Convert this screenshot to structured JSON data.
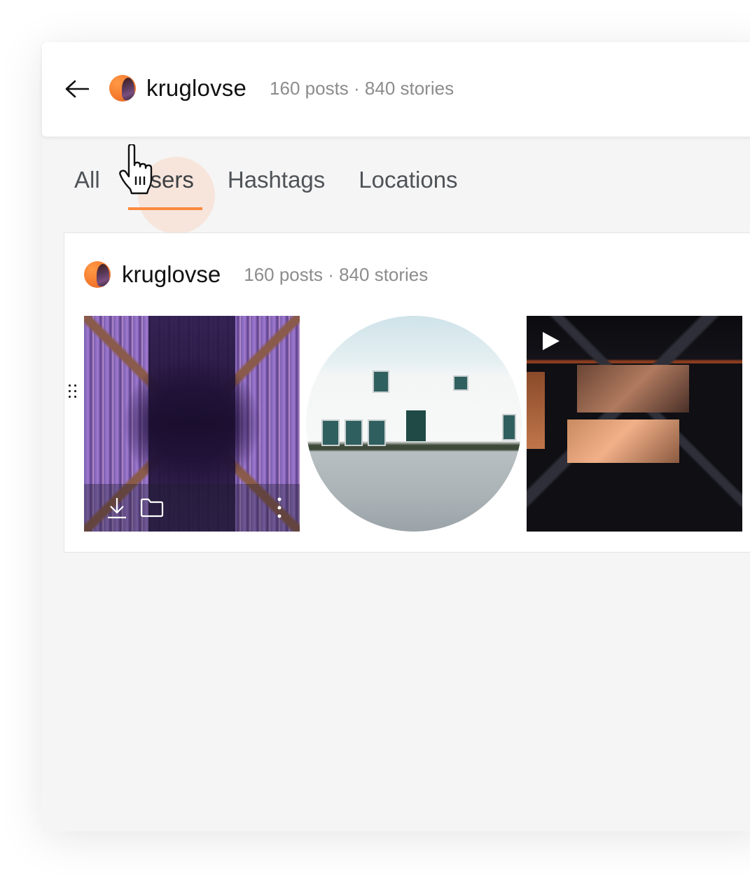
{
  "header": {
    "back_label": "Back",
    "username": "kruglovse",
    "stats": "160 posts · 840 stories"
  },
  "tabs": [
    {
      "label": "All",
      "active": false
    },
    {
      "label": "Users",
      "active": true
    },
    {
      "label": "Hashtags",
      "active": false
    },
    {
      "label": "Locations",
      "active": false
    }
  ],
  "result_card": {
    "username": "kruglovse",
    "stats": "160 posts · 840 stories",
    "media": [
      {
        "type": "post",
        "subject": "gothic cathedral ceiling with stained glass",
        "actions": [
          "download-icon",
          "folder-icon",
          "more-vertical-icon"
        ]
      },
      {
        "type": "story",
        "subject": "white stucco houses with courtyard"
      },
      {
        "type": "video",
        "subject": "night glass building with lit apartments",
        "overlay": "play-icon"
      }
    ]
  },
  "colors": {
    "accent": "#fb8a3f",
    "text_primary": "#111111",
    "text_secondary": "#8c8c8c",
    "tab_text": "#4f5358",
    "background": "#f5f5f5"
  }
}
